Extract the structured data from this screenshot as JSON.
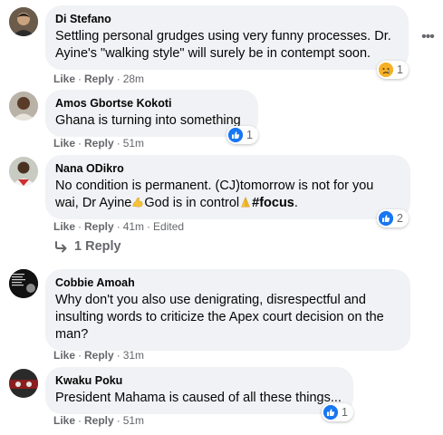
{
  "comments": [
    {
      "author": "Di Stefano",
      "text": "Settling personal grudges using very funny processes. Dr. Ayine's \"walking style\" will surely be in contempt soon.",
      "like": "Like",
      "reply": "Reply",
      "time": "28m",
      "reaction_count": "1",
      "reaction_type": "sad-icon"
    },
    {
      "author": "Amos Gbortse Kokoti",
      "text": "Ghana is turning into something",
      "like": "Like",
      "reply": "Reply",
      "time": "51m",
      "reaction_count": "1",
      "reaction_type": "like-icon"
    },
    {
      "author": "Nana ODikro",
      "text_line1": "No condition is permanent. (CJ)tomorrow is not for you",
      "text_line2_a": "wai, Dr Ayine",
      "text_line2_b": "God is in control",
      "hashtag": "#focus",
      "text_line2_end": ".",
      "like": "Like",
      "reply": "Reply",
      "time": "41m",
      "edited": "Edited",
      "reaction_count": "2",
      "reaction_type": "like-icon",
      "replies_link": "1 Reply",
      "emoji1": "flexed-biceps-icon",
      "emoji2": "folded-hands-icon"
    },
    {
      "author": "Cobbie Amoah",
      "text": "Why don't you also use denigrating, disrespectful and insulting words to criticize the Apex court decision on the man?",
      "like": "Like",
      "reply": "Reply",
      "time": "31m"
    },
    {
      "author": "Kwaku Poku",
      "text": "President Mahama is caused of all these things...",
      "like": "Like",
      "reply": "Reply",
      "time": "51m",
      "reaction_count": "1",
      "reaction_type": "like-icon"
    }
  ],
  "colors": {
    "bubble": "#f0f2f5",
    "meta": "#65676b",
    "like_blue": "#1877f2",
    "sad_yellow": "#f7b125"
  }
}
